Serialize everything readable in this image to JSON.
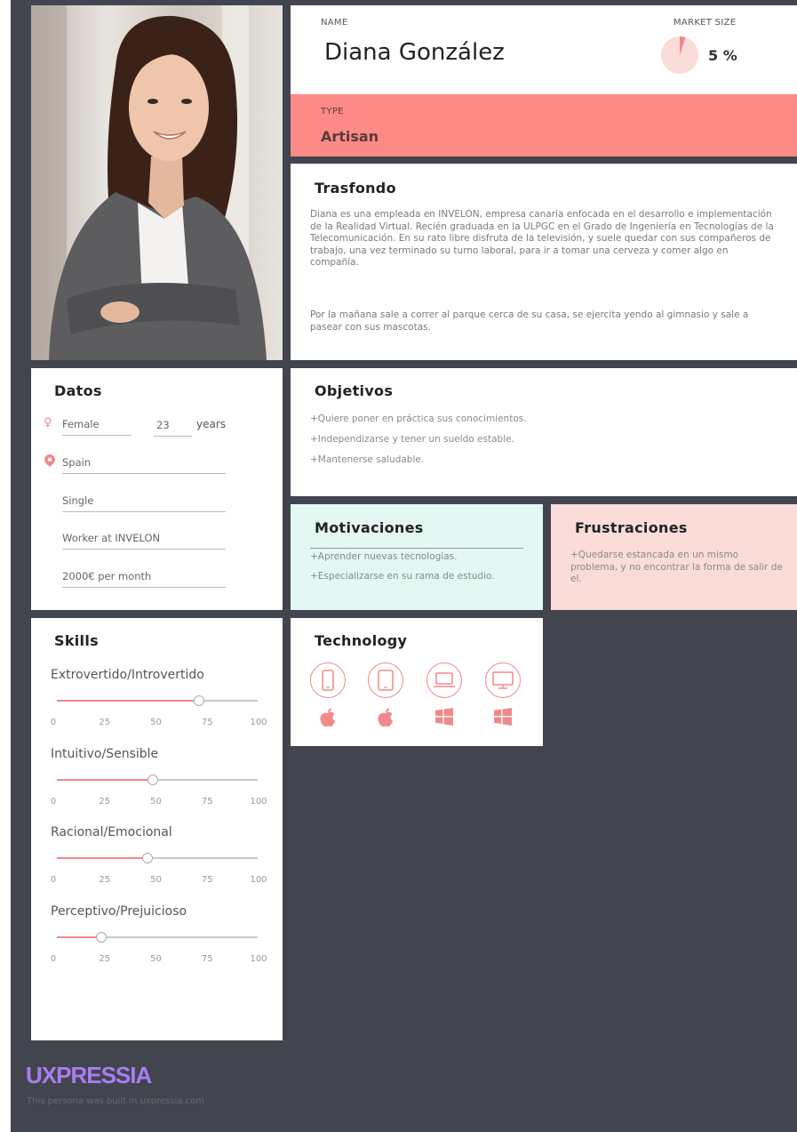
{
  "persona": {
    "name_label": "NAME",
    "name": "Diana González",
    "market_label": "MARKET SIZE",
    "market_value": "5 %",
    "market_fraction": 0.05,
    "type_label": "TYPE",
    "type": "Artisan"
  },
  "background": {
    "title": "Trasfondo",
    "p1": "Diana es una empleada en INVELON, empresa canaria enfocada en el desarrollo e implementación de la Realidad Virtual. Recién graduada en la ULPGC en el Grado de Ingeniería en Tecnologías de la Telecomunicación. En su rato libre disfruta de la televisión, y suele quedar con sus compañeros de trabajo, una vez terminado su turno laboral, para ir a tomar una cerveza y comer algo en compañía.",
    "p2": "Por la mañana sale a correr al parque cerca de su casa, se ejercita yendo al gimnasio y sale a pasear con sus mascotas."
  },
  "datos": {
    "title": "Datos",
    "gender": "Female",
    "age": "23",
    "age_unit": "years",
    "country": "Spain",
    "status": "Single",
    "job": "Worker at INVELON",
    "income": "2000€ per month"
  },
  "objetivos": {
    "title": "Objetivos",
    "items": [
      "+Quiere poner en práctica sus conocimientos.",
      "+Independizarse y tener un sueldo estable.",
      "+Mantenerse saludable."
    ]
  },
  "motivaciones": {
    "title": "Motivaciones",
    "items": [
      "+Aprender nuevas tecnologias.",
      "+Especializarse en su rama de estudio."
    ]
  },
  "frustraciones": {
    "title": "Frustraciones",
    "text": "+Quedarse estancada en un mismo problema, y no encontrar la forma de salir de el."
  },
  "skills": {
    "title": "Skills",
    "ticks": [
      "0",
      "25",
      "50",
      "75",
      "100"
    ],
    "items": [
      {
        "label": "Extrovertido/Introvertido",
        "value": 71
      },
      {
        "label": "Intuitivo/Sensible",
        "value": 48
      },
      {
        "label": "Racional/Emocional",
        "value": 45
      },
      {
        "label": "Perceptivo/Prejuicioso",
        "value": 22
      }
    ]
  },
  "technology": {
    "title": "Technology",
    "devices": [
      "smartphone-icon",
      "tablet-icon",
      "laptop-icon",
      "desktop-icon"
    ],
    "os": [
      "apple-icon",
      "apple-icon",
      "windows-icon",
      "windows-icon"
    ]
  },
  "brand": {
    "logo": "UXPRESSIA",
    "footer": "This persona was built in uxpressia.com"
  },
  "colors": {
    "accent": "#f08a8a",
    "type_band": "#fd8a86",
    "motivaciones_bg": "#e3f7f3",
    "frustraciones_bg": "#fadcd9",
    "dark_bg": "#42454d",
    "logo": "#a97cf2"
  }
}
